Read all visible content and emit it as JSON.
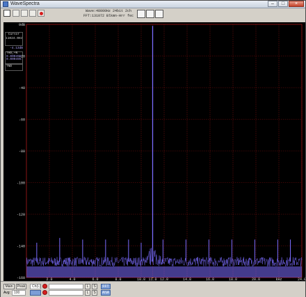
{
  "window": {
    "title": "WaveSpectra"
  },
  "toolbar": {
    "info_line1": "Wave:48000Hz 24bit 2ch",
    "info_line2": "FFT:131072 Blkmn-Hrr fec"
  },
  "side": {
    "cursor_label": "Cursor",
    "cursor_freq": "11024.0Hz",
    "cursor_db": "-4.13dB",
    "thd_label": "THD,+N",
    "thd_l": "0.00045%",
    "thd_r": "0.00045%",
    "tnd_label": "TND"
  },
  "status": {
    "main_label": "Main",
    "peak_label": "Peak",
    "ch_label": "Ch(L)",
    "avg_label": "Avg:",
    "avg_value": "100",
    "l_label": "L",
    "s_label": "S",
    "fft_label": "FFT",
    "ana_label": "ANA"
  },
  "chart_data": {
    "type": "line",
    "title": "",
    "xlabel": "",
    "ylabel": "",
    "xlim": [
      0,
      24
    ],
    "ylim": [
      -160,
      0
    ],
    "y_tick_labels": [
      "0dB",
      "-20",
      "-40",
      "-60",
      "-80",
      "-100",
      "-120",
      "-140",
      "-160"
    ],
    "y_ticks": [
      0,
      -20,
      -40,
      -60,
      -80,
      -100,
      -120,
      -140,
      -160
    ],
    "x_tick_labels": [
      "2.0",
      "4.0",
      "6.0",
      "8.0",
      "10.0",
      "11.0",
      "12.0",
      "14.0",
      "16.0",
      "18.0",
      "20.0",
      "kHz",
      "24.0"
    ],
    "x_ticks": [
      2,
      4,
      6,
      8,
      10,
      11,
      12,
      14,
      16,
      18,
      20,
      22,
      24
    ],
    "grid": true,
    "noise_floor_db": -150,
    "series": [
      {
        "x": [
          0.1,
          2,
          4,
          6,
          7.5,
          9,
          10.5,
          11,
          11.5,
          13,
          14.5,
          16,
          17.5,
          19,
          21,
          23,
          23.9
        ],
        "values": [
          -150,
          -150,
          -150,
          -150,
          -150,
          -150,
          -150,
          -1,
          -150,
          -150,
          -150,
          -150,
          -150,
          -150,
          -150,
          -150,
          -150
        ]
      }
    ],
    "spurs_khz": [
      0.9,
      2.9,
      4.9,
      6.9,
      8.9,
      10.0,
      11.9,
      13.9,
      15.9,
      17.9,
      19.9,
      21.9,
      23.0
    ],
    "spurs_db": [
      -138,
      -135,
      -136,
      -136,
      -136,
      -138,
      -136,
      -136,
      -136,
      -136,
      -136,
      -136,
      -136
    ],
    "colors": {
      "background": "#000000",
      "grid": "#7a0d0d",
      "trace": "#7b6cff",
      "marker": "#cc7a00"
    }
  }
}
